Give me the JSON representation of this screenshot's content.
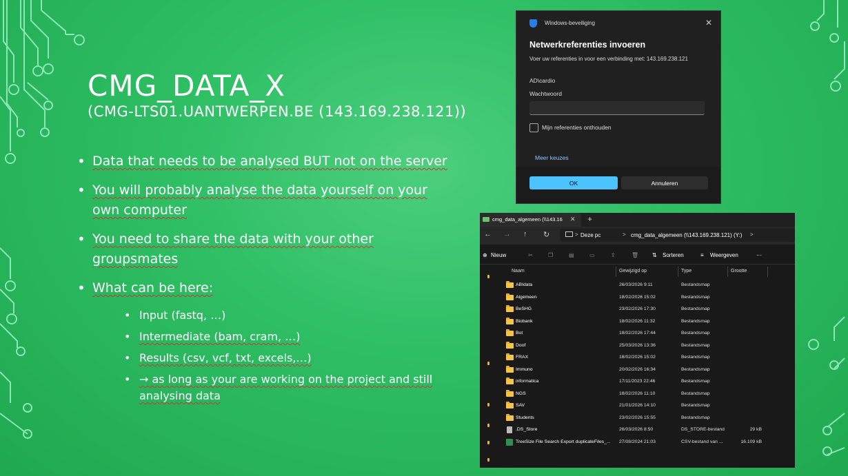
{
  "slide": {
    "title": "CMG_DATA_X",
    "subtitle": "(CMG-LTS01.UANTWERPEN.BE (143.169.238.121))",
    "bullets": [
      "Data that needs to be analysed BUT not on the server",
      "You will probably analyse the data yourself on your own computer",
      "You need to share the data with your other groupsmates",
      "What can be here:"
    ],
    "sub_bullets": [
      "Input (fastq, …)",
      "Intermediate (bam, cram, …)",
      "Results (csv, vcf, txt, excels,…)",
      "→ as long as your are working on the project and still analysing data"
    ]
  },
  "dialog": {
    "app_name": "Windows-beveiliging",
    "close": "✕",
    "title": "Netwerkreferenties invoeren",
    "description": "Voer uw referenties in voor een verbinding met: 143.169.238.121",
    "username": "AD\\cardio",
    "password_label": "Wachtwoord",
    "password_value": "",
    "remember_label": "Mijn referenties onthouden",
    "more_choices": "Meer keuzes",
    "ok": "OK",
    "cancel": "Annuleren"
  },
  "explorer": {
    "tab_title": "cmg_data_algemeen (\\\\143.16",
    "tab_close": "✕",
    "new_tab": "+",
    "nav": {
      "back": "←",
      "forward": "→",
      "up": "↑",
      "refresh": "↻"
    },
    "address": {
      "pc": "Deze pc",
      "path": "cmg_data_algemeen (\\\\143.169.238.121) (Y:)",
      "sep": ">"
    },
    "toolbar": {
      "new": "Nieuw",
      "sort": "Sorteren",
      "view": "Weergeven",
      "more": "···"
    },
    "columns": {
      "name": "Naam",
      "modified": "Gewijzigd op",
      "type": "Type",
      "size": "Grootte"
    },
    "rows": [
      {
        "name": "ABIdata",
        "modified": "26/03/2026 9:11",
        "type": "Bestandsmap",
        "size": "",
        "icon": "folder-icon"
      },
      {
        "name": "Algemeen",
        "modified": "18/02/2026 15:02",
        "type": "Bestandsmap",
        "size": "",
        "icon": "folder-icon"
      },
      {
        "name": "BeSHG",
        "modified": "23/02/2026 17:30",
        "type": "Bestandsmap",
        "size": "",
        "icon": "folder-icon"
      },
      {
        "name": "Biobank",
        "modified": "18/02/2026 11:32",
        "type": "Bestandsmap",
        "size": "",
        "icon": "folder-icon"
      },
      {
        "name": "Bot",
        "modified": "18/02/2026 17:44",
        "type": "Bestandsmap",
        "size": "",
        "icon": "folder-icon"
      },
      {
        "name": "Doof",
        "modified": "25/03/2026 13:36",
        "type": "Bestandsmap",
        "size": "",
        "icon": "folder-icon"
      },
      {
        "name": "FRAX",
        "modified": "18/02/2026 15:02",
        "type": "Bestandsmap",
        "size": "",
        "icon": "folder-icon"
      },
      {
        "name": "Immuno",
        "modified": "20/02/2026 16:34",
        "type": "Bestandsmap",
        "size": "",
        "icon": "folder-icon"
      },
      {
        "name": "informatica",
        "modified": "17/11/2023 22:46",
        "type": "Bestandsmap",
        "size": "",
        "icon": "folder-icon"
      },
      {
        "name": "NGS",
        "modified": "18/02/2026 11:10",
        "type": "Bestandsmap",
        "size": "",
        "icon": "folder-icon"
      },
      {
        "name": "SAV",
        "modified": "21/01/2026 14:10",
        "type": "Bestandsmap",
        "size": "",
        "icon": "folder-icon"
      },
      {
        "name": "Students",
        "modified": "23/02/2026 15:55",
        "type": "Bestandsmap",
        "size": "",
        "icon": "folder-icon"
      },
      {
        "name": ".DS_Store",
        "modified": "26/03/2026 8:50",
        "type": "DS_STORE-bestand",
        "size": "29 kB",
        "icon": "file-icon"
      },
      {
        "name": "TreeSize File Search Export duplicateFiles_...",
        "modified": "27/08/2024 21:03",
        "type": "CSV-bestand van ...",
        "size": "16.109 kB",
        "icon": "csv-file-icon"
      }
    ]
  }
}
